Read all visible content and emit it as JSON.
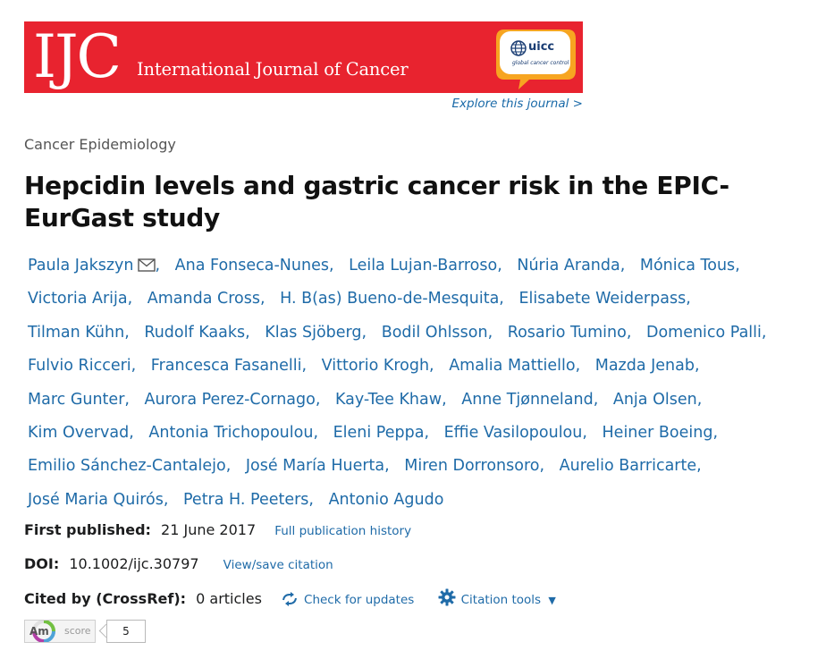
{
  "banner": {
    "logo_text": "IJC",
    "journal_name": "International Journal of Cancer",
    "partner_logo_text": "uicc",
    "partner_tagline": "global cancer control"
  },
  "explore_link": "Explore this journal >",
  "category": "Cancer Epidemiology",
  "title": "Hepcidin levels and gastric cancer risk in the EPIC-EurGast study",
  "authors": [
    "Paula Jakszyn",
    "Ana Fonseca-Nunes",
    "Leila Lujan-Barroso",
    "Núria Aranda",
    "Mónica Tous",
    "Victoria Arija",
    "Amanda Cross",
    "H. B(as) Bueno-de-Mesquita",
    "Elisabete Weiderpass",
    "Tilman Kühn",
    "Rudolf Kaaks",
    "Klas Sjöberg",
    "Bodil Ohlsson",
    "Rosario Tumino",
    "Domenico Palli",
    "Fulvio Ricceri",
    "Francesca Fasanelli",
    "Vittorio Krogh",
    "Amalia Mattiello",
    "Mazda Jenab",
    "Marc Gunter",
    "Aurora Perez-Cornago",
    "Kay-Tee Khaw",
    "Anne Tjønneland",
    "Anja Olsen",
    "Kim Overvad",
    "Antonia Trichopoulou",
    "Eleni Peppa",
    "Effie Vasilopoulou",
    "Heiner Boeing",
    "Emilio Sánchez-Cantalejo",
    "José María Huerta",
    "Miren Dorronsoro",
    "Aurelio Barricarte",
    "José Maria Quirós",
    "Petra H. Peeters",
    "Antonio Agudo"
  ],
  "first_published": {
    "label": "First published:",
    "value": "21 June 2017",
    "link": "Full publication history"
  },
  "doi": {
    "label": "DOI:",
    "value": "10.1002/ijc.30797",
    "link": "View/save citation"
  },
  "cited_by": {
    "label": "Cited by (CrossRef):",
    "value": "0 articles",
    "check_updates": "Check for updates",
    "citation_tools": "Citation tools"
  },
  "altmetric": {
    "logo": "Am",
    "label": "score",
    "count": "5"
  },
  "colors": {
    "banner_red": "#e8232f",
    "link_blue": "#1f6ba8",
    "uicc_orange": "#f7a521"
  }
}
